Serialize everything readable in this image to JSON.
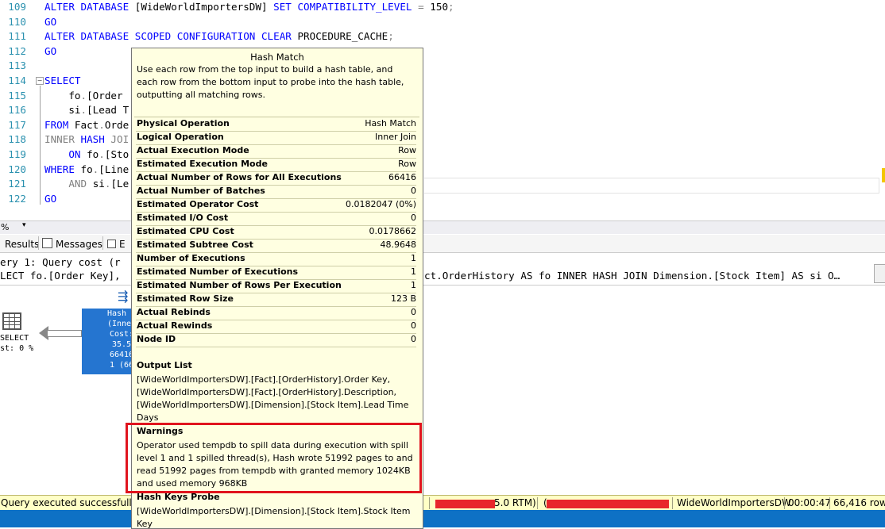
{
  "editor": {
    "lines": [
      {
        "num": "109",
        "tokens": [
          [
            "kw",
            "ALTER DATABASE "
          ],
          [
            "txt",
            "[WideWorldImportersDW] "
          ],
          [
            "kw",
            "SET COMPATIBILITY_LEVEL "
          ],
          [
            "gy",
            "= "
          ],
          [
            "txt",
            "150"
          ],
          [
            "gy",
            ";"
          ]
        ]
      },
      {
        "num": "110",
        "tokens": [
          [
            "kw",
            "GO"
          ]
        ]
      },
      {
        "num": "111",
        "tokens": [
          [
            "kw",
            "ALTER DATABASE SCOPED CONFIGURATION CLEAR "
          ],
          [
            "txt",
            "PROCEDURE_CACHE"
          ],
          [
            "gy",
            ";"
          ]
        ]
      },
      {
        "num": "112",
        "tokens": [
          [
            "kw",
            "GO"
          ]
        ]
      },
      {
        "num": "113",
        "tokens": []
      },
      {
        "num": "114",
        "tokens": [
          [
            "kw",
            "SELECT"
          ]
        ]
      },
      {
        "num": "115",
        "tokens": [
          [
            "txt",
            "    fo"
          ],
          [
            "gy",
            "."
          ],
          [
            "txt",
            "[Order"
          ]
        ]
      },
      {
        "num": "116",
        "tokens": [
          [
            "txt",
            "    si"
          ],
          [
            "gy",
            "."
          ],
          [
            "txt",
            "[Lead T"
          ]
        ]
      },
      {
        "num": "117",
        "tokens": [
          [
            "kw",
            "FROM "
          ],
          [
            "txt",
            "Fact"
          ],
          [
            "gy",
            "."
          ],
          [
            "txt",
            "Orde"
          ]
        ]
      },
      {
        "num": "118",
        "tokens": [
          [
            "gy",
            "INNER "
          ],
          [
            "kw",
            "HASH "
          ],
          [
            "gy",
            "JOI"
          ]
        ]
      },
      {
        "num": "119",
        "tokens": [
          [
            "txt",
            "    "
          ],
          [
            "kw",
            "ON "
          ],
          [
            "txt",
            "fo"
          ],
          [
            "gy",
            "."
          ],
          [
            "txt",
            "[Sto"
          ]
        ]
      },
      {
        "num": "120",
        "tokens": [
          [
            "kw",
            "WHERE "
          ],
          [
            "txt",
            "fo"
          ],
          [
            "gy",
            "."
          ],
          [
            "txt",
            "[Line"
          ]
        ]
      },
      {
        "num": "121",
        "tokens": [
          [
            "txt",
            "    "
          ],
          [
            "gy",
            "AND "
          ],
          [
            "txt",
            "si"
          ],
          [
            "gy",
            "."
          ],
          [
            "txt",
            "[Le"
          ]
        ]
      },
      {
        "num": "122",
        "tokens": [
          [
            "kw",
            "GO"
          ]
        ]
      }
    ]
  },
  "zoom": {
    "value": "%"
  },
  "tabs": {
    "results": "Results",
    "messages": "Messages",
    "execution_plan": "E"
  },
  "plan": {
    "query_cost_line": "ery 1: Query cost (r",
    "query_text_left": "LECT fo.[Order Key],",
    "query_text_right": "ct.OrderHistory AS fo INNER HASH JOIN Dimension.[Stock Item] AS si O…",
    "select_node": {
      "label": "SELECT",
      "cost": "st: 0 %"
    },
    "hash_node": {
      "lines": [
        "Hash M",
        "(Inner",
        "Cost:",
        "35.5",
        "66416",
        "1 (66"
      ]
    }
  },
  "tooltip": {
    "title": "Hash Match",
    "description": "Use each row from the top input to build a hash table, and each row from the bottom input to probe into the hash table, outputting all matching rows.",
    "properties": [
      {
        "name": "Physical Operation",
        "value": "Hash Match"
      },
      {
        "name": "Logical Operation",
        "value": "Inner Join"
      },
      {
        "name": "Actual Execution Mode",
        "value": "Row"
      },
      {
        "name": "Estimated Execution Mode",
        "value": "Row"
      },
      {
        "name": "Actual Number of Rows for All Executions",
        "value": "66416"
      },
      {
        "name": "Actual Number of Batches",
        "value": "0"
      },
      {
        "name": "Estimated Operator Cost",
        "value": "0.0182047 (0%)"
      },
      {
        "name": "Estimated I/O Cost",
        "value": "0"
      },
      {
        "name": "Estimated CPU Cost",
        "value": "0.0178662"
      },
      {
        "name": "Estimated Subtree Cost",
        "value": "48.9648"
      },
      {
        "name": "Number of Executions",
        "value": "1"
      },
      {
        "name": "Estimated Number of Executions",
        "value": "1"
      },
      {
        "name": "Estimated Number of Rows Per Execution",
        "value": "1"
      },
      {
        "name": "Estimated Row Size",
        "value": "123 B"
      },
      {
        "name": "Actual Rebinds",
        "value": "0"
      },
      {
        "name": "Actual Rewinds",
        "value": "0"
      },
      {
        "name": "Node ID",
        "value": "0"
      }
    ],
    "output_list": {
      "heading": "Output List",
      "text": "[WideWorldImportersDW].[Fact].[OrderHistory].Order Key, [WideWorldImportersDW].[Fact].[OrderHistory].Description, [WideWorldImportersDW].[Dimension].[Stock Item].Lead Time Days"
    },
    "warnings": {
      "heading": "Warnings",
      "text": "Operator used tempdb to spill data during execution with spill level 1 and 1 spilled thread(s), Hash wrote 51992 pages to and read 51992 pages from tempdb with granted memory 1024KB and used memory 968KB"
    },
    "hash_keys_probe": {
      "heading": "Hash Keys Probe",
      "text": "[WideWorldImportersDW].[Dimension].[Stock Item].Stock Item Key"
    }
  },
  "status": {
    "message": "Query executed successfully.",
    "server_suffix": "5.0 RTM)",
    "database": "WideWorldImportersDW",
    "elapsed": "00:00:47",
    "rows": "66,416 rows"
  },
  "colors": {
    "keyword": "#0000ff",
    "operator_gray": "#808080",
    "line_number": "#2b91af",
    "tooltip_bg": "#ffffe1",
    "highlight_border": "#e0141e",
    "plan_node": "#2575d0",
    "status_bg": "#ffffc6"
  }
}
